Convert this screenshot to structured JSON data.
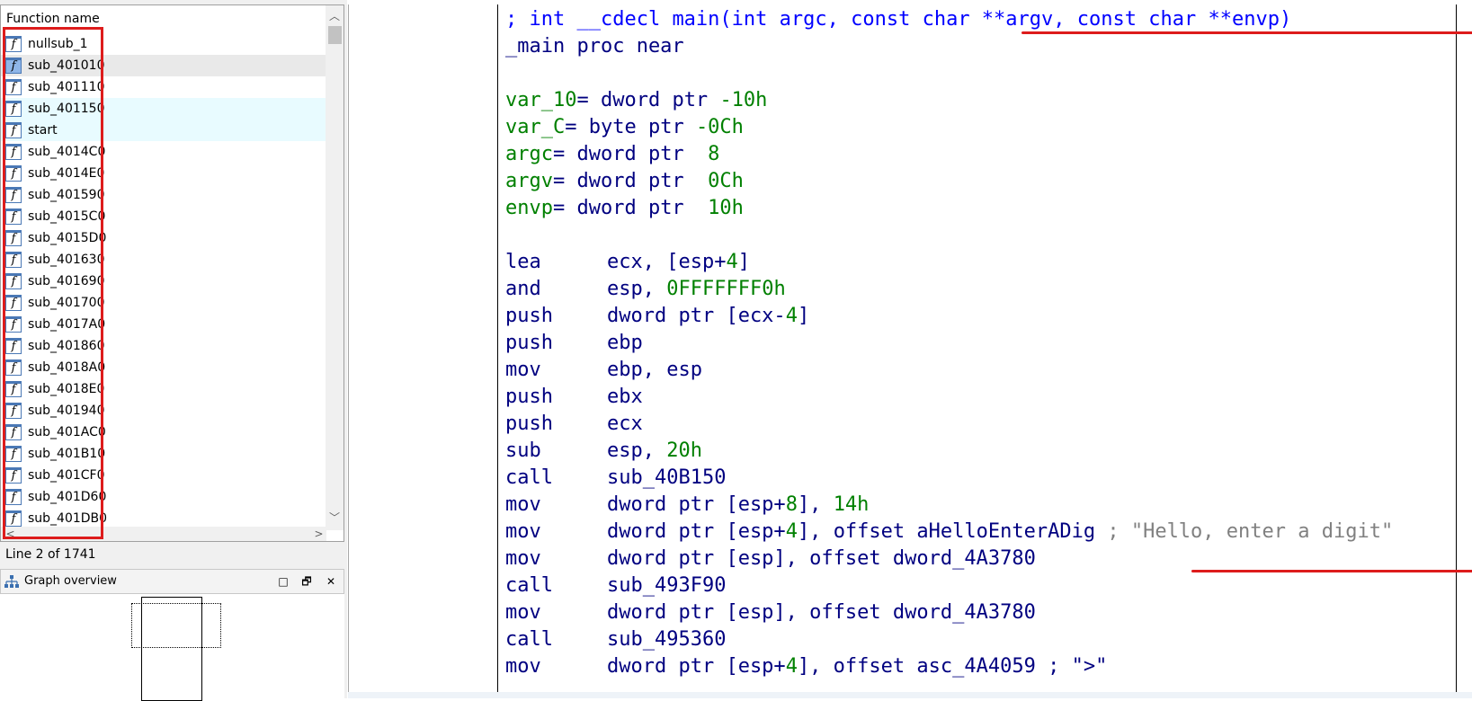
{
  "functions_panel": {
    "header": "Function name",
    "items": [
      {
        "name": "nullsub_1",
        "state": ""
      },
      {
        "name": "sub_401010",
        "state": "selected"
      },
      {
        "name": "sub_401110",
        "state": ""
      },
      {
        "name": "sub_401150",
        "state": "lib"
      },
      {
        "name": "start",
        "state": "lib"
      },
      {
        "name": "sub_4014C0",
        "state": ""
      },
      {
        "name": "sub_4014E0",
        "state": ""
      },
      {
        "name": "sub_401590",
        "state": ""
      },
      {
        "name": "sub_4015C0",
        "state": ""
      },
      {
        "name": "sub_4015D0",
        "state": ""
      },
      {
        "name": "sub_401630",
        "state": ""
      },
      {
        "name": "sub_401690",
        "state": ""
      },
      {
        "name": "sub_401700",
        "state": ""
      },
      {
        "name": "sub_4017A0",
        "state": ""
      },
      {
        "name": "sub_401860",
        "state": ""
      },
      {
        "name": "sub_4018A0",
        "state": ""
      },
      {
        "name": "sub_4018E0",
        "state": ""
      },
      {
        "name": "sub_401940",
        "state": ""
      },
      {
        "name": "sub_401AC0",
        "state": ""
      },
      {
        "name": "sub_401B10",
        "state": ""
      },
      {
        "name": "sub_401CF0",
        "state": ""
      },
      {
        "name": "sub_401D60",
        "state": ""
      },
      {
        "name": "sub_401DB0",
        "state": ""
      }
    ],
    "function_icon_glyph": "f",
    "status_line": "Line 2 of 1741"
  },
  "graph_overview": {
    "title": "Graph overview",
    "buttons": {
      "maximize": "□",
      "restore": "🗗",
      "close": "✕"
    }
  },
  "disassembly": {
    "lines": [
      {
        "segs": [
          {
            "t": "; int __cdecl ",
            "c": "cm"
          },
          {
            "t": "main(int argc, const char **argv, const char **envp)",
            "c": "cm"
          }
        ]
      },
      {
        "segs": [
          {
            "t": "_main proc near",
            "c": ""
          }
        ]
      },
      {
        "segs": []
      },
      {
        "segs": [
          {
            "t": "var_10",
            "c": "gr"
          },
          {
            "t": "= dword ptr ",
            "c": ""
          },
          {
            "t": "-10h",
            "c": "gr"
          }
        ]
      },
      {
        "segs": [
          {
            "t": "var_C",
            "c": "gr"
          },
          {
            "t": "= byte ptr ",
            "c": ""
          },
          {
            "t": "-0Ch",
            "c": "gr"
          }
        ]
      },
      {
        "segs": [
          {
            "t": "argc",
            "c": "gr"
          },
          {
            "t": "= dword ptr  ",
            "c": ""
          },
          {
            "t": "8",
            "c": "gr"
          }
        ]
      },
      {
        "segs": [
          {
            "t": "argv",
            "c": "gr"
          },
          {
            "t": "= dword ptr  ",
            "c": ""
          },
          {
            "t": "0Ch",
            "c": "gr"
          }
        ]
      },
      {
        "segs": [
          {
            "t": "envp",
            "c": "gr"
          },
          {
            "t": "= dword ptr  ",
            "c": ""
          },
          {
            "t": "10h",
            "c": "gr"
          }
        ]
      },
      {
        "segs": []
      },
      {
        "mn": "lea",
        "segs": [
          {
            "t": "ecx, [esp+",
            "c": ""
          },
          {
            "t": "4",
            "c": "gr"
          },
          {
            "t": "]",
            "c": ""
          }
        ]
      },
      {
        "mn": "and",
        "segs": [
          {
            "t": "esp, ",
            "c": ""
          },
          {
            "t": "0FFFFFFF0h",
            "c": "gr"
          }
        ]
      },
      {
        "mn": "push",
        "segs": [
          {
            "t": "dword ptr [ecx-",
            "c": ""
          },
          {
            "t": "4",
            "c": "gr"
          },
          {
            "t": "]",
            "c": ""
          }
        ]
      },
      {
        "mn": "push",
        "segs": [
          {
            "t": "ebp",
            "c": ""
          }
        ]
      },
      {
        "mn": "mov",
        "segs": [
          {
            "t": "ebp, esp",
            "c": ""
          }
        ]
      },
      {
        "mn": "push",
        "segs": [
          {
            "t": "ebx",
            "c": ""
          }
        ]
      },
      {
        "mn": "push",
        "segs": [
          {
            "t": "ecx",
            "c": ""
          }
        ]
      },
      {
        "mn": "sub",
        "segs": [
          {
            "t": "esp, ",
            "c": ""
          },
          {
            "t": "20h",
            "c": "gr"
          }
        ]
      },
      {
        "mn": "call",
        "segs": [
          {
            "t": "sub_40B150",
            "c": ""
          }
        ]
      },
      {
        "mn": "mov",
        "segs": [
          {
            "t": "dword ptr [esp+",
            "c": ""
          },
          {
            "t": "8",
            "c": "gr"
          },
          {
            "t": "], ",
            "c": ""
          },
          {
            "t": "14h",
            "c": "gr"
          }
        ]
      },
      {
        "mn": "mov",
        "segs": [
          {
            "t": "dword ptr [esp+",
            "c": ""
          },
          {
            "t": "4",
            "c": "gr"
          },
          {
            "t": "], ",
            "c": ""
          },
          {
            "t": "offset aHelloEnterADig",
            "c": ""
          },
          {
            "t": " ; \"Hello, enter a digit\"",
            "c": "gy"
          }
        ]
      },
      {
        "mn": "mov",
        "segs": [
          {
            "t": "dword ptr [esp], offset dword_4A3780",
            "c": ""
          }
        ]
      },
      {
        "mn": "call",
        "segs": [
          {
            "t": "sub_493F90",
            "c": ""
          }
        ]
      },
      {
        "mn": "mov",
        "segs": [
          {
            "t": "dword ptr [esp], offset dword_4A3780",
            "c": ""
          }
        ]
      },
      {
        "mn": "call",
        "segs": [
          {
            "t": "sub_495360",
            "c": ""
          }
        ]
      },
      {
        "mn": "mov",
        "segs": [
          {
            "t": "dword ptr [esp+",
            "c": ""
          },
          {
            "t": "4",
            "c": "gr"
          },
          {
            "t": "], offset asc_4A4059 ; \">\"",
            "c": ""
          }
        ]
      }
    ]
  },
  "colors": {
    "disasm_default": "#000080",
    "disasm_comment": "#0000ff",
    "disasm_numeric": "#008000",
    "disasm_string_comment": "#808080",
    "annotation_red": "#dd1c1c",
    "list_selected_bg": "#e9e9e9",
    "list_library_bg": "#e8fbff"
  }
}
